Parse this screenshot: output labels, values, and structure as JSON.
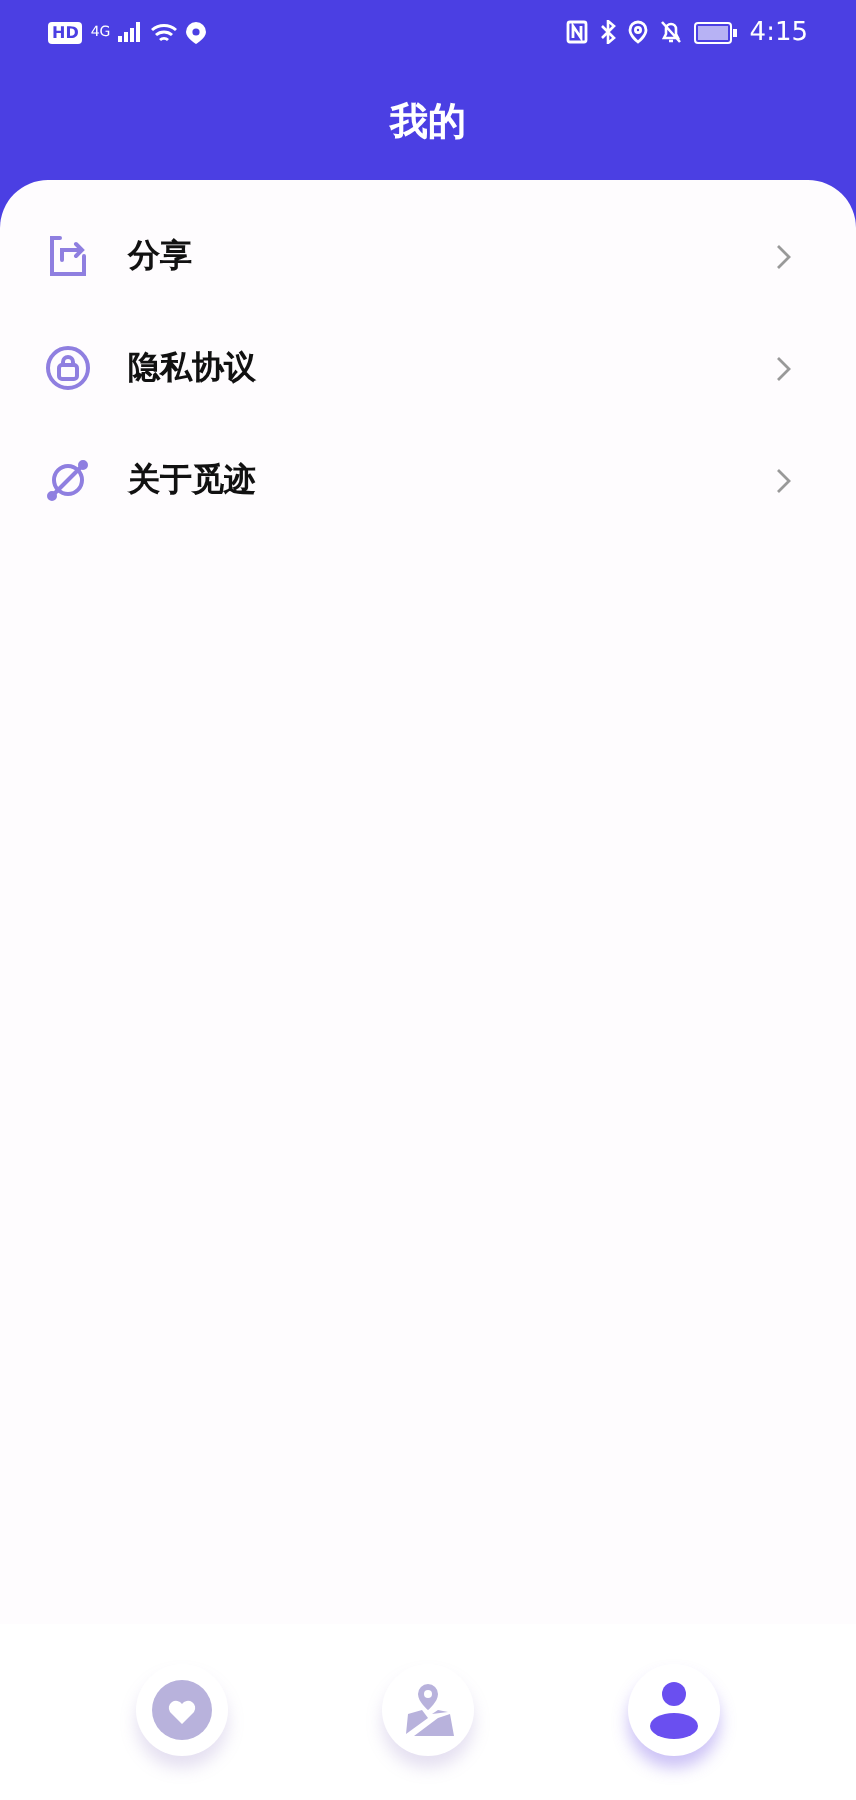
{
  "status_bar": {
    "time": "4:15",
    "network": "4G",
    "hd": "HD"
  },
  "header": {
    "title": "我的"
  },
  "menu": [
    {
      "kind": "share",
      "label": "分享"
    },
    {
      "kind": "privacy",
      "label": "隐私协议"
    },
    {
      "kind": "about",
      "label": "关于觅迹"
    }
  ],
  "tabs": [
    {
      "kind": "favorites",
      "selected": false
    },
    {
      "kind": "map",
      "selected": false
    },
    {
      "kind": "profile",
      "selected": true
    }
  ]
}
